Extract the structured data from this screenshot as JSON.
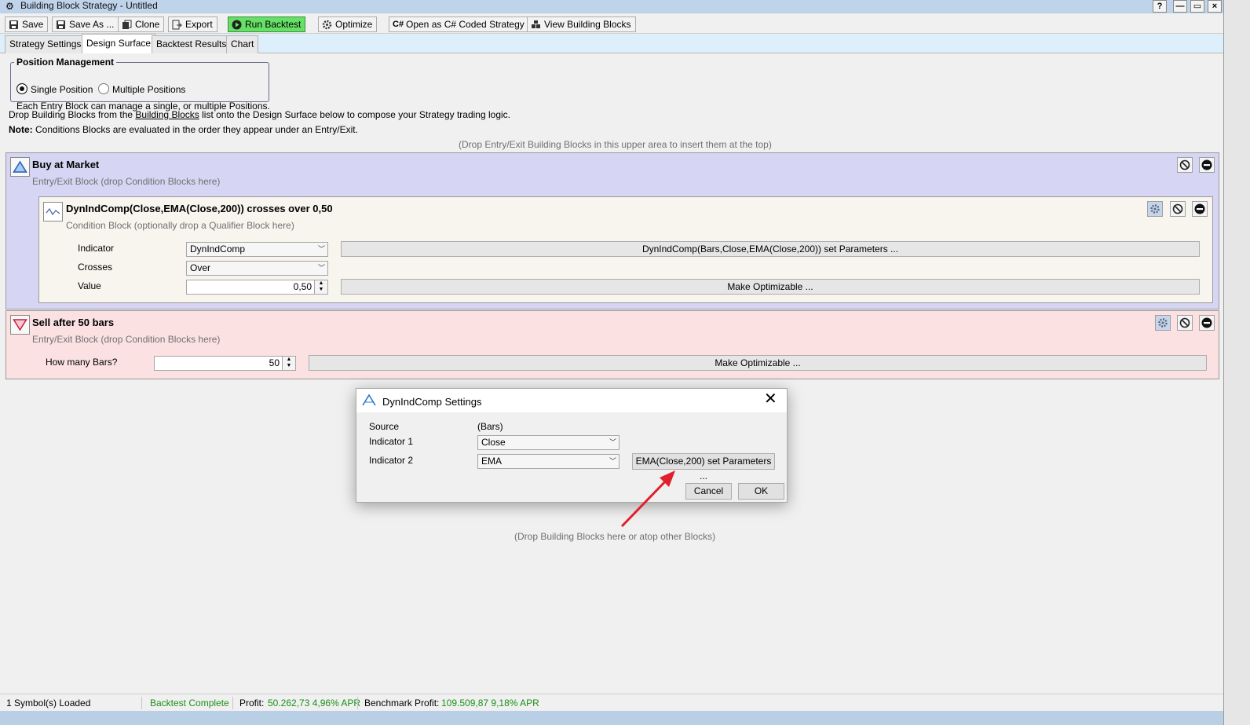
{
  "window": {
    "title": "Building Block Strategy - Untitled",
    "help": "?",
    "min": "—",
    "max": "▭",
    "close": "×"
  },
  "toolbar": {
    "save": "Save",
    "save_as": "Save As ...",
    "clone": "Clone",
    "export": "Export",
    "run_backtest": "Run Backtest",
    "optimize": "Optimize",
    "open_csharp": "Open as C# Coded Strategy",
    "view_blocks": "View Building Blocks"
  },
  "tabs": [
    "Strategy Settings",
    "Design Surface",
    "Backtest Results",
    "Chart"
  ],
  "position_management": {
    "legend": "Position Management",
    "single": "Single Position",
    "multiple": "Multiple Positions",
    "desc": "Each Entry Block can manage a single, or multiple Positions."
  },
  "instructions": {
    "pre": "Drop Building Blocks from the ",
    "link": "Building Blocks",
    "post": " list onto the Design Surface below to compose your Strategy trading logic.",
    "note_label": "Note:",
    "note_text": " Conditions Blocks are evaluated in the order they appear under an Entry/Exit.",
    "drop_top": "(Drop Entry/Exit Building Blocks in this upper area to insert them at the top)",
    "drop_bottom": "(Drop Building Blocks here or atop other Blocks)"
  },
  "buy_block": {
    "title": "Buy at Market",
    "subtitle": "Entry/Exit Block (drop Condition Blocks here)",
    "color": "#d6d6f4",
    "condition": {
      "title": "DynIndComp(Close,EMA(Close,200)) crosses over 0,50",
      "subtitle": "Condition Block (optionally drop a Qualifier Block here)",
      "indicator_label": "Indicator",
      "indicator_value": "DynIndComp",
      "crosses_label": "Crosses",
      "crosses_value": "Over",
      "value_label": "Value",
      "value_value": "0,50",
      "params_button": "DynIndComp(Bars,Close,EMA(Close,200)) set Parameters ...",
      "optimizable_button": "Make Optimizable ..."
    }
  },
  "sell_block": {
    "title": "Sell after 50 bars",
    "subtitle": "Entry/Exit Block (drop Condition Blocks here)",
    "color": "#fbe1e1",
    "bars_label": "How many Bars?",
    "bars_value": "50",
    "optimizable_button": "Make Optimizable ..."
  },
  "dialog": {
    "title": "DynIndComp Settings",
    "source_label": "Source",
    "source_value": "(Bars)",
    "ind1_label": "Indicator 1",
    "ind1_value": "Close",
    "ind2_label": "Indicator 2",
    "ind2_value": "EMA",
    "params_button": "EMA(Close,200) set Parameters ...",
    "cancel": "Cancel",
    "ok": "OK"
  },
  "status": {
    "symbols": "1 Symbol(s) Loaded",
    "backtest": "Backtest Complete",
    "profit_label": "Profit:",
    "profit_value": "50.262,73 4,96% APR",
    "bench_label": "Benchmark Profit:",
    "bench_value": "109.509,87 9,18% APR"
  }
}
